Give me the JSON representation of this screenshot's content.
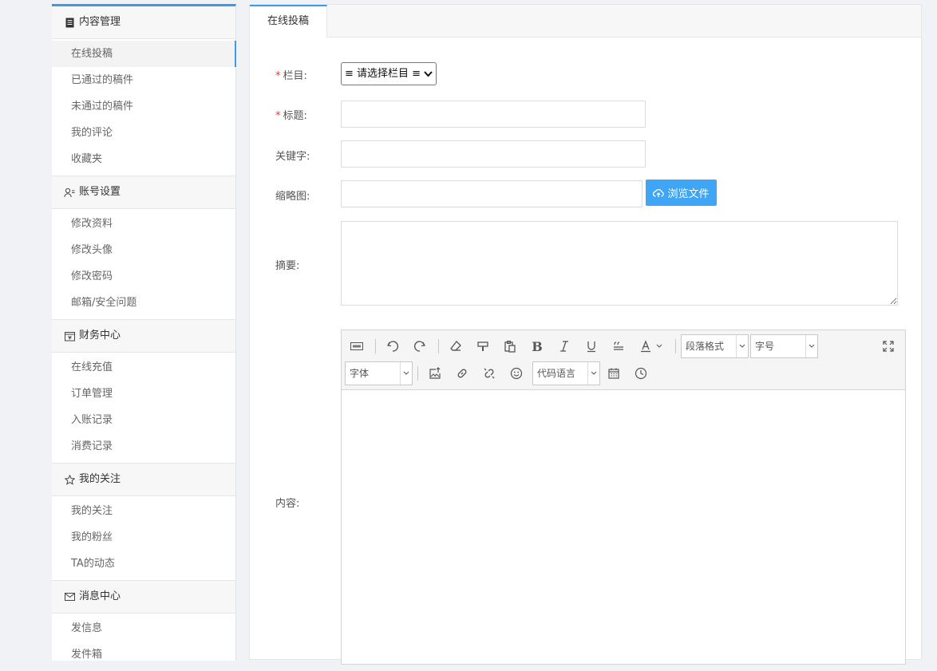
{
  "sidebar": {
    "groups": [
      {
        "title": "内容管理",
        "icon": "document-icon",
        "items": [
          "在线投稿",
          "已通过的稿件",
          "未通过的稿件",
          "我的评论",
          "收藏夹"
        ]
      },
      {
        "title": "账号设置",
        "icon": "user-settings-icon",
        "items": [
          "修改资料",
          "修改头像",
          "修改密码",
          "邮箱/安全问题"
        ]
      },
      {
        "title": "财务中心",
        "icon": "wallet-icon",
        "items": [
          "在线充值",
          "订单管理",
          "入账记录",
          "消费记录"
        ]
      },
      {
        "title": "我的关注",
        "icon": "star-icon",
        "items": [
          "我的关注",
          "我的粉丝",
          "TA的动态"
        ]
      },
      {
        "title": "消息中心",
        "icon": "mail-icon",
        "items": [
          "发信息",
          "发件箱"
        ]
      }
    ],
    "active_item": "在线投稿"
  },
  "main": {
    "tab_label": "在线投稿",
    "form": {
      "category_label": "栏目:",
      "category_value": "≡ 请选择栏目 ≡",
      "title_label": "标题:",
      "title_value": "",
      "keywords_label": "关键字:",
      "keywords_value": "",
      "thumbnail_label": "缩略图:",
      "thumbnail_value": "",
      "browse_button": "浏览文件",
      "summary_label": "摘要:",
      "content_label": "内容:",
      "required_mark": "*"
    },
    "editor": {
      "paragraph_format": "段落格式",
      "font_size": "字号",
      "font_family": "字体",
      "code_language": "代码语言"
    }
  },
  "colors": {
    "accent": "#3a9be8",
    "button": "#3fa5f5",
    "required": "#e4393c"
  }
}
